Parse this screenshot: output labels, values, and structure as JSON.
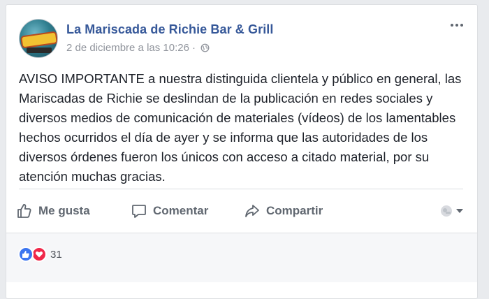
{
  "post": {
    "page_name": "La Mariscada de Richie Bar & Grill",
    "timestamp": "2 de diciembre a las 10:26",
    "separator": "·",
    "text": "AVISO IMPORTANTE a nuestra distinguida clientela y público en general, las Mariscadas de Richie se deslindan de la publicación en redes sociales y diversos medios de comunicación de materiales (vídeos) de los lamentables hechos ocurridos el día de ayer y se informa que las autoridades de los diversos órdenes fueron los únicos con acceso a citado material, por su atención muchas gracias."
  },
  "actions": {
    "like_label": "Me gusta",
    "comment_label": "Comentar",
    "share_label": "Compartir"
  },
  "reactions": {
    "count": "31"
  },
  "colors": {
    "link": "#365899",
    "meta": "#90949c",
    "action": "#606770",
    "like": "#3b75f0",
    "love": "#f0284a"
  }
}
